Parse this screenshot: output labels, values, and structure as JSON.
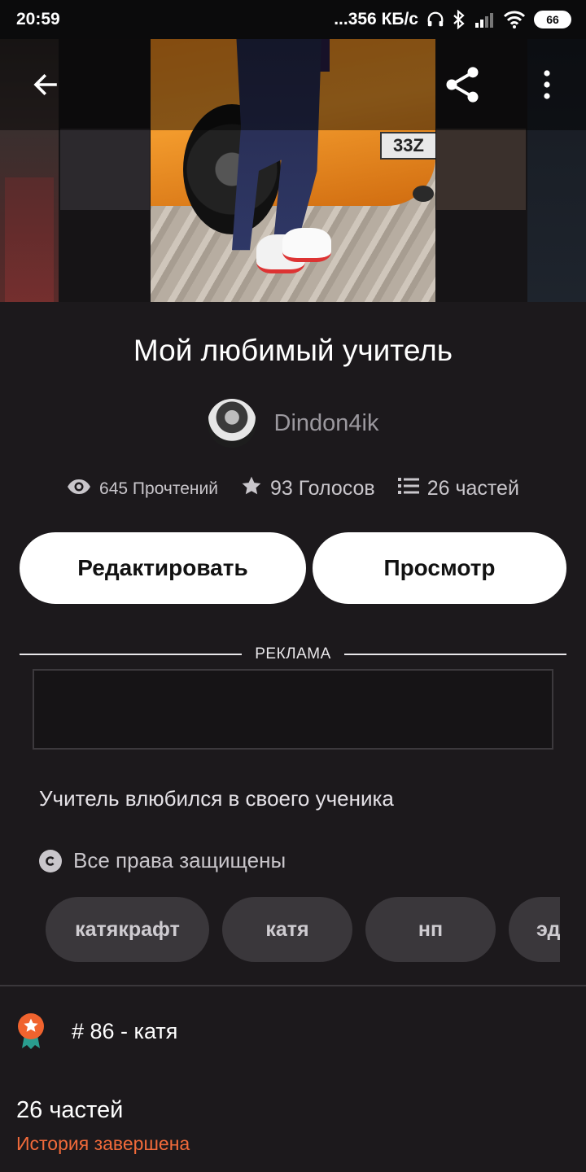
{
  "status_bar": {
    "time": "20:59",
    "network_speed": "...356 КБ/с",
    "battery": "66"
  },
  "top_bar": {
    "back_icon": "arrow-left-icon",
    "share_icon": "share-icon",
    "more_icon": "more-vertical-icon"
  },
  "story": {
    "title": "Мой любимый учитель",
    "author": "Dindon4ik",
    "cover_plate_text": "33Z",
    "stats": {
      "reads": "645 Прочтений",
      "votes": "93 Голосов",
      "parts": "26 частей"
    },
    "description": "Учитель влюбился в своего ученика",
    "rights": "Все права защищены",
    "tags": [
      "катякрафт",
      "катя",
      "нп",
      "эд"
    ],
    "rank": "# 86 - катя",
    "parts_count": "26 частей",
    "status": "История завершена"
  },
  "actions": {
    "edit_label": "Редактировать",
    "view_label": "Просмотр"
  },
  "ad": {
    "label": "РЕКЛАМА"
  },
  "colors": {
    "background": "#1c191c",
    "accent_orange": "#f26a3a",
    "button_bg": "#ffffff",
    "tag_bg": "#3a373b",
    "badge_orange": "#f0632e",
    "badge_ribbon": "#2a9d8f"
  }
}
